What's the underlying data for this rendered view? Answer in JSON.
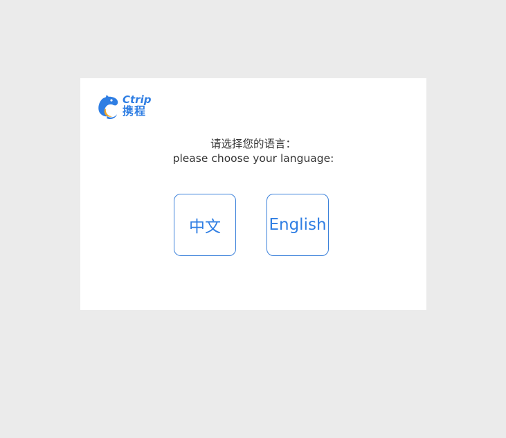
{
  "logo": {
    "brand_en": "Ctrip",
    "brand_cn": "携程",
    "icon": "dolphin-logo-icon",
    "color": "#2f7ee3",
    "accent": "#f5a623"
  },
  "prompt": {
    "chinese": "请选择您的语言：",
    "english": "please choose your language:"
  },
  "languages": {
    "chinese_label": "中文",
    "english_label": "English"
  },
  "colors": {
    "background": "#ebebeb",
    "panel": "#ffffff",
    "accent": "#2f7ee3",
    "text": "#333333"
  }
}
